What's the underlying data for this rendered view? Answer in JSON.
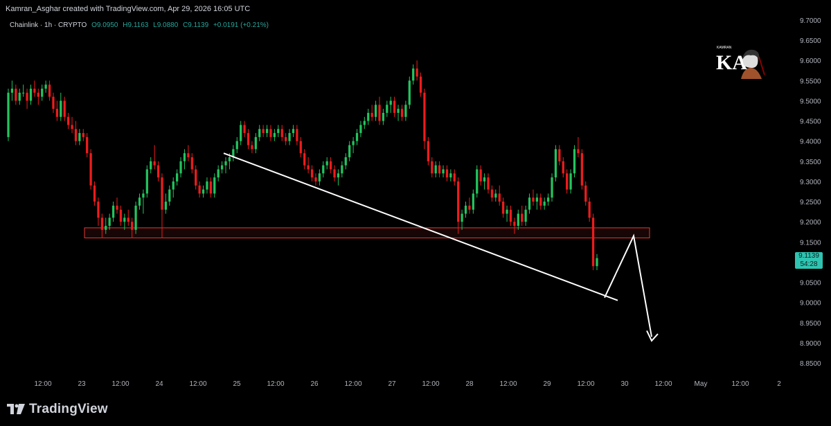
{
  "header": {
    "caption": "Kamran_Asghar created with TradingView.com, Apr 29, 2026 16:05 UTC"
  },
  "legend": {
    "symbol": "Chainlink · 1h · CRYPTO",
    "open": "O9.0950",
    "high": "H9.1163",
    "low": "L9.0880",
    "close": "C9.1139",
    "change": "+0.0191 (+0.21%)"
  },
  "price_tag": {
    "price": "9.1139",
    "countdown": "54:28"
  },
  "brand": {
    "wordmark": "TradingView"
  },
  "watermark": {
    "text": "KAMRAN",
    "initials": "KA"
  },
  "colors": {
    "up": "#26a69a",
    "up_bright": "#22c55e",
    "down": "#ef1c1c",
    "line": "#ffffff",
    "zone": "#e53935",
    "price_tag": "#2fc4b2"
  },
  "chart_data": {
    "type": "candlestick",
    "timeframe": "1h",
    "y_ticks": [
      "9.7000",
      "9.6500",
      "9.6000",
      "9.5500",
      "9.5000",
      "9.4500",
      "9.4000",
      "9.3500",
      "9.3000",
      "9.2500",
      "9.2000",
      "9.1500",
      "9.1000",
      "9.0500",
      "9.0000",
      "8.9500",
      "8.9000",
      "8.8500"
    ],
    "ylim": [
      8.83,
      9.72
    ],
    "x_ticks": [
      "12:00",
      "23",
      "12:00",
      "24",
      "12:00",
      "25",
      "12:00",
      "26",
      "12:00",
      "27",
      "12:00",
      "28",
      "12:00",
      "29",
      "12:00",
      "30",
      "12:00",
      "May",
      "12:00",
      "2"
    ],
    "candles": [
      [
        9.41,
        9.53,
        9.4,
        9.52
      ],
      [
        9.52,
        9.55,
        9.5,
        9.53
      ],
      [
        9.53,
        9.54,
        9.49,
        9.5
      ],
      [
        9.5,
        9.53,
        9.49,
        9.52
      ],
      [
        9.52,
        9.54,
        9.51,
        9.52
      ],
      [
        9.52,
        9.53,
        9.48,
        9.5
      ],
      [
        9.5,
        9.54,
        9.49,
        9.53
      ],
      [
        9.53,
        9.55,
        9.51,
        9.52
      ],
      [
        9.52,
        9.53,
        9.49,
        9.51
      ],
      [
        9.51,
        9.54,
        9.5,
        9.53
      ],
      [
        9.53,
        9.55,
        9.52,
        9.54
      ],
      [
        9.54,
        9.55,
        9.5,
        9.51
      ],
      [
        9.51,
        9.52,
        9.47,
        9.48
      ],
      [
        9.48,
        9.5,
        9.45,
        9.46
      ],
      [
        9.46,
        9.52,
        9.45,
        9.5
      ],
      [
        9.5,
        9.51,
        9.45,
        9.46
      ],
      [
        9.46,
        9.47,
        9.43,
        9.44
      ],
      [
        9.44,
        9.46,
        9.42,
        9.43
      ],
      [
        9.43,
        9.45,
        9.39,
        9.4
      ],
      [
        9.4,
        9.43,
        9.39,
        9.42
      ],
      [
        9.42,
        9.43,
        9.4,
        9.41
      ],
      [
        9.41,
        9.42,
        9.36,
        9.37
      ],
      [
        9.37,
        9.38,
        9.28,
        9.29
      ],
      [
        9.29,
        9.3,
        9.24,
        9.25
      ],
      [
        9.25,
        9.26,
        9.19,
        9.21
      ],
      [
        9.21,
        9.22,
        9.16,
        9.18
      ],
      [
        9.18,
        9.21,
        9.17,
        9.19
      ],
      [
        9.19,
        9.22,
        9.18,
        9.21
      ],
      [
        9.21,
        9.25,
        9.2,
        9.24
      ],
      [
        9.24,
        9.26,
        9.22,
        9.23
      ],
      [
        9.23,
        9.24,
        9.19,
        9.2
      ],
      [
        9.2,
        9.22,
        9.18,
        9.21
      ],
      [
        9.21,
        9.23,
        9.19,
        9.2
      ],
      [
        9.2,
        9.21,
        9.16,
        9.18
      ],
      [
        9.18,
        9.25,
        9.17,
        9.24
      ],
      [
        9.24,
        9.27,
        9.23,
        9.26
      ],
      [
        9.26,
        9.28,
        9.22,
        9.27
      ],
      [
        9.27,
        9.34,
        9.26,
        9.33
      ],
      [
        9.33,
        9.36,
        9.32,
        9.35
      ],
      [
        9.35,
        9.39,
        9.33,
        9.34
      ],
      [
        9.34,
        9.35,
        9.3,
        9.31
      ],
      [
        9.31,
        9.32,
        9.16,
        9.23
      ],
      [
        9.23,
        9.27,
        9.22,
        9.25
      ],
      [
        9.25,
        9.29,
        9.24,
        9.28
      ],
      [
        9.28,
        9.31,
        9.26,
        9.3
      ],
      [
        9.3,
        9.33,
        9.29,
        9.32
      ],
      [
        9.32,
        9.36,
        9.31,
        9.35
      ],
      [
        9.35,
        9.38,
        9.33,
        9.37
      ],
      [
        9.37,
        9.39,
        9.35,
        9.36
      ],
      [
        9.36,
        9.37,
        9.32,
        9.33
      ],
      [
        9.33,
        9.34,
        9.28,
        9.29
      ],
      [
        9.29,
        9.3,
        9.26,
        9.27
      ],
      [
        9.27,
        9.29,
        9.26,
        9.28
      ],
      [
        9.28,
        9.31,
        9.27,
        9.3
      ],
      [
        9.3,
        9.31,
        9.26,
        9.27
      ],
      [
        9.27,
        9.32,
        9.26,
        9.31
      ],
      [
        9.31,
        9.34,
        9.3,
        9.33
      ],
      [
        9.33,
        9.35,
        9.32,
        9.34
      ],
      [
        9.34,
        9.36,
        9.32,
        9.35
      ],
      [
        9.35,
        9.37,
        9.33,
        9.36
      ],
      [
        9.36,
        9.39,
        9.35,
        9.38
      ],
      [
        9.38,
        9.41,
        9.37,
        9.4
      ],
      [
        9.4,
        9.45,
        9.39,
        9.44
      ],
      [
        9.44,
        9.45,
        9.41,
        9.42
      ],
      [
        9.42,
        9.43,
        9.38,
        9.39
      ],
      [
        9.39,
        9.4,
        9.37,
        9.38
      ],
      [
        9.38,
        9.42,
        9.37,
        9.41
      ],
      [
        9.41,
        9.44,
        9.4,
        9.43
      ],
      [
        9.43,
        9.44,
        9.41,
        9.42
      ],
      [
        9.42,
        9.44,
        9.41,
        9.43
      ],
      [
        9.43,
        9.44,
        9.4,
        9.41
      ],
      [
        9.41,
        9.43,
        9.4,
        9.42
      ],
      [
        9.42,
        9.44,
        9.41,
        9.43
      ],
      [
        9.43,
        9.44,
        9.4,
        9.41
      ],
      [
        9.41,
        9.42,
        9.39,
        9.4
      ],
      [
        9.4,
        9.43,
        9.39,
        9.42
      ],
      [
        9.42,
        9.44,
        9.41,
        9.43
      ],
      [
        9.43,
        9.44,
        9.39,
        9.4
      ],
      [
        9.4,
        9.41,
        9.36,
        9.37
      ],
      [
        9.37,
        9.38,
        9.33,
        9.34
      ],
      [
        9.34,
        9.36,
        9.32,
        9.33
      ],
      [
        9.33,
        9.34,
        9.3,
        9.31
      ],
      [
        9.31,
        9.32,
        9.29,
        9.3
      ],
      [
        9.3,
        9.33,
        9.29,
        9.32
      ],
      [
        9.32,
        9.35,
        9.31,
        9.34
      ],
      [
        9.34,
        9.36,
        9.33,
        9.35
      ],
      [
        9.35,
        9.36,
        9.32,
        9.33
      ],
      [
        9.33,
        9.34,
        9.3,
        9.31
      ],
      [
        9.31,
        9.33,
        9.29,
        9.32
      ],
      [
        9.32,
        9.35,
        9.31,
        9.34
      ],
      [
        9.34,
        9.37,
        9.33,
        9.36
      ],
      [
        9.36,
        9.4,
        9.35,
        9.39
      ],
      [
        9.39,
        9.41,
        9.37,
        9.4
      ],
      [
        9.4,
        9.43,
        9.39,
        9.42
      ],
      [
        9.42,
        9.45,
        9.41,
        9.44
      ],
      [
        9.44,
        9.46,
        9.43,
        9.45
      ],
      [
        9.45,
        9.48,
        9.44,
        9.47
      ],
      [
        9.47,
        9.49,
        9.45,
        9.46
      ],
      [
        9.46,
        9.5,
        9.45,
        9.49
      ],
      [
        9.49,
        9.51,
        9.44,
        9.45
      ],
      [
        9.45,
        9.48,
        9.44,
        9.47
      ],
      [
        9.47,
        9.5,
        9.46,
        9.49
      ],
      [
        9.49,
        9.51,
        9.47,
        9.5
      ],
      [
        9.5,
        9.51,
        9.46,
        9.47
      ],
      [
        9.47,
        9.49,
        9.45,
        9.48
      ],
      [
        9.48,
        9.49,
        9.45,
        9.46
      ],
      [
        9.46,
        9.5,
        9.45,
        9.49
      ],
      [
        9.49,
        9.56,
        9.48,
        9.55
      ],
      [
        9.55,
        9.59,
        9.54,
        9.58
      ],
      [
        9.58,
        9.6,
        9.55,
        9.56
      ],
      [
        9.56,
        9.57,
        9.51,
        9.52
      ],
      [
        9.52,
        9.53,
        9.38,
        9.4
      ],
      [
        9.4,
        9.41,
        9.34,
        9.35
      ],
      [
        9.35,
        9.36,
        9.31,
        9.32
      ],
      [
        9.32,
        9.35,
        9.31,
        9.34
      ],
      [
        9.34,
        9.35,
        9.31,
        9.32
      ],
      [
        9.32,
        9.34,
        9.31,
        9.33
      ],
      [
        9.33,
        9.34,
        9.3,
        9.31
      ],
      [
        9.31,
        9.33,
        9.3,
        9.32
      ],
      [
        9.32,
        9.33,
        9.29,
        9.3
      ],
      [
        9.3,
        9.31,
        9.17,
        9.2
      ],
      [
        9.2,
        9.23,
        9.18,
        9.22
      ],
      [
        9.22,
        9.25,
        9.21,
        9.24
      ],
      [
        9.24,
        9.26,
        9.22,
        9.23
      ],
      [
        9.23,
        9.28,
        9.22,
        9.27
      ],
      [
        9.27,
        9.34,
        9.26,
        9.33
      ],
      [
        9.33,
        9.34,
        9.29,
        9.3
      ],
      [
        9.3,
        9.32,
        9.28,
        9.31
      ],
      [
        9.31,
        9.32,
        9.27,
        9.28
      ],
      [
        9.28,
        9.29,
        9.25,
        9.26
      ],
      [
        9.26,
        9.28,
        9.25,
        9.27
      ],
      [
        9.27,
        9.29,
        9.24,
        9.25
      ],
      [
        9.25,
        9.26,
        9.21,
        9.22
      ],
      [
        9.22,
        9.24,
        9.2,
        9.23
      ],
      [
        9.23,
        9.24,
        9.19,
        9.2
      ],
      [
        9.2,
        9.21,
        9.17,
        9.19
      ],
      [
        9.19,
        9.23,
        9.18,
        9.22
      ],
      [
        9.22,
        9.24,
        9.19,
        9.2
      ],
      [
        9.2,
        9.24,
        9.19,
        9.23
      ],
      [
        9.23,
        9.27,
        9.22,
        9.26
      ],
      [
        9.26,
        9.28,
        9.24,
        9.25
      ],
      [
        9.25,
        9.27,
        9.23,
        9.26
      ],
      [
        9.26,
        9.27,
        9.23,
        9.24
      ],
      [
        9.24,
        9.26,
        9.23,
        9.25
      ],
      [
        9.25,
        9.27,
        9.24,
        9.26
      ],
      [
        9.26,
        9.32,
        9.25,
        9.31
      ],
      [
        9.31,
        9.39,
        9.3,
        9.38
      ],
      [
        9.38,
        9.39,
        9.34,
        9.35
      ],
      [
        9.35,
        9.36,
        9.31,
        9.32
      ],
      [
        9.32,
        9.33,
        9.27,
        9.28
      ],
      [
        9.28,
        9.33,
        9.27,
        9.32
      ],
      [
        9.32,
        9.39,
        9.31,
        9.38
      ],
      [
        9.38,
        9.41,
        9.36,
        9.37
      ],
      [
        9.37,
        9.38,
        9.28,
        9.29
      ],
      [
        9.29,
        9.3,
        9.24,
        9.25
      ],
      [
        9.25,
        9.26,
        9.2,
        9.21
      ],
      [
        9.21,
        9.22,
        9.08,
        9.09
      ],
      [
        9.09,
        9.12,
        9.08,
        9.11
      ]
    ],
    "annotations": {
      "support_zone": [
        9.16,
        9.185
      ],
      "trendline": [
        [
          0,
          9.37
        ],
        [
          1,
          9.005
        ]
      ],
      "projection": [
        "9.005",
        "9.17",
        "8.91"
      ]
    }
  }
}
